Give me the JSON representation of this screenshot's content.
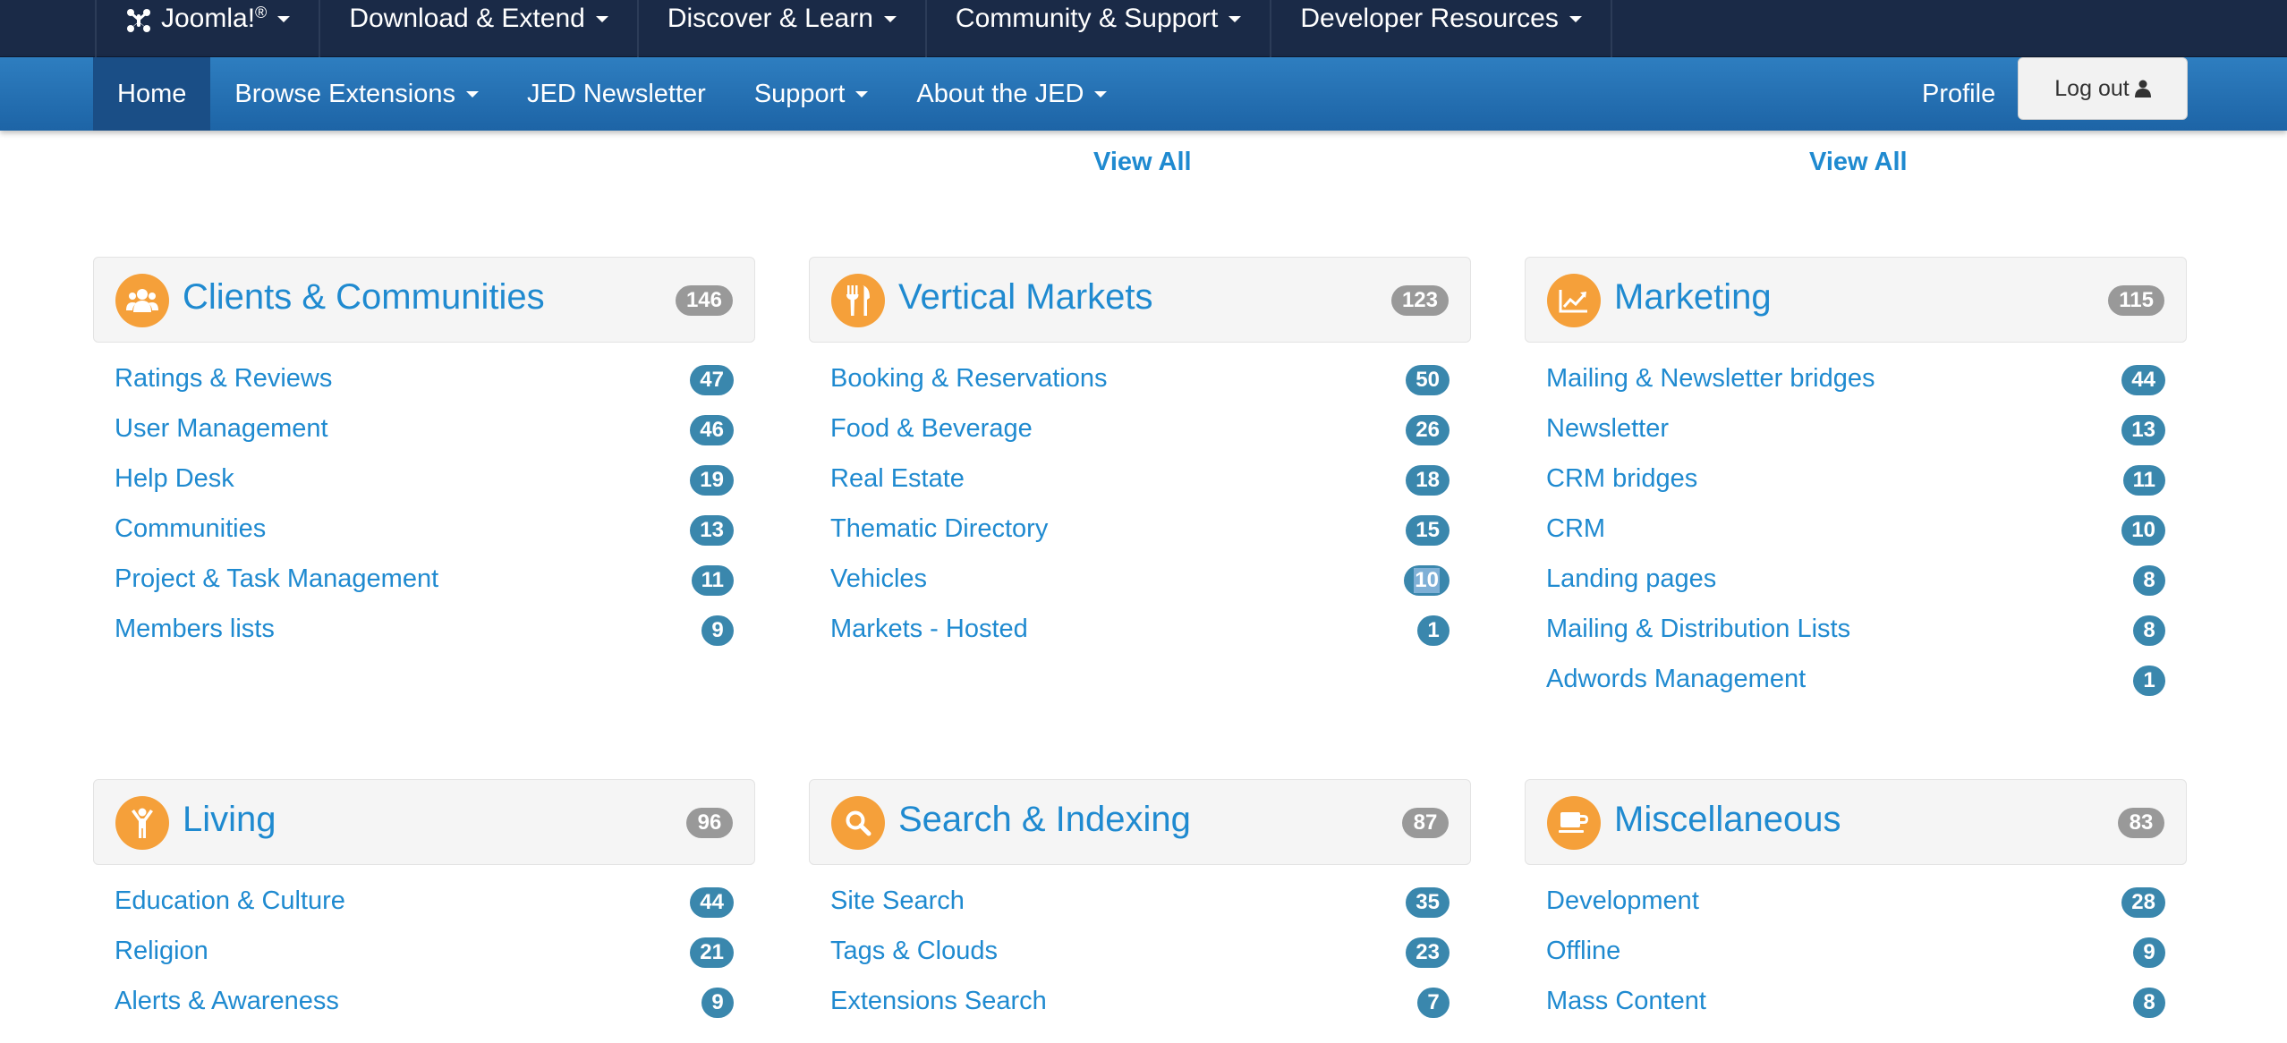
{
  "topbar": {
    "items": [
      {
        "label": "Joomla!",
        "sup": "®"
      },
      {
        "label": "Download & Extend"
      },
      {
        "label": "Discover & Learn"
      },
      {
        "label": "Community & Support"
      },
      {
        "label": "Developer Resources"
      }
    ],
    "icons": {
      "logo": "joomla-logo-icon",
      "caret": "caret-down-icon"
    }
  },
  "mainnav": {
    "items": [
      {
        "label": "Home",
        "active": true
      },
      {
        "label": "Browse Extensions",
        "dropdown": true
      },
      {
        "label": "JED Newsletter",
        "dropdown": false
      },
      {
        "label": "Support",
        "dropdown": true
      },
      {
        "label": "About the JED",
        "dropdown": true
      }
    ],
    "profile": "Profile",
    "logout": "Log out",
    "logout_icon": "user-icon"
  },
  "view_all": [
    "View All",
    "View All"
  ],
  "colors": {
    "link": "#1f8ad0",
    "icon_circle": "#f5a03a",
    "badge": "#3a87ad",
    "badge_total": "#999999",
    "topbar": "#1a2a47",
    "mainnav": "#2472b6"
  },
  "categories": [
    {
      "title": "Clients & Communities",
      "count": "146",
      "icon": "users-icon",
      "items": [
        {
          "name": "Ratings & Reviews",
          "count": "47"
        },
        {
          "name": "User Management",
          "count": "46"
        },
        {
          "name": "Help Desk",
          "count": "19"
        },
        {
          "name": "Communities",
          "count": "13"
        },
        {
          "name": "Project & Task Management",
          "count": "11"
        },
        {
          "name": "Members lists",
          "count": "9"
        }
      ]
    },
    {
      "title": "Vertical Markets",
      "count": "123",
      "icon": "fork-knife-icon",
      "items": [
        {
          "name": "Booking & Reservations",
          "count": "50"
        },
        {
          "name": "Food & Beverage",
          "count": "26"
        },
        {
          "name": "Real Estate",
          "count": "18"
        },
        {
          "name": "Thematic Directory",
          "count": "15"
        },
        {
          "name": "Vehicles",
          "count": "10"
        },
        {
          "name": "Markets - Hosted",
          "count": "1"
        }
      ]
    },
    {
      "title": "Marketing",
      "count": "115",
      "icon": "line-chart-icon",
      "items": [
        {
          "name": "Mailing & Newsletter bridges",
          "count": "44"
        },
        {
          "name": "Newsletter",
          "count": "13"
        },
        {
          "name": "CRM bridges",
          "count": "11"
        },
        {
          "name": "CRM",
          "count": "10"
        },
        {
          "name": "Landing pages",
          "count": "8"
        },
        {
          "name": "Mailing & Distribution Lists",
          "count": "8"
        },
        {
          "name": "Adwords Management",
          "count": "1"
        }
      ]
    },
    {
      "title": "Living",
      "count": "96",
      "icon": "person-icon",
      "items": [
        {
          "name": "Education & Culture",
          "count": "44"
        },
        {
          "name": "Religion",
          "count": "21"
        },
        {
          "name": "Alerts & Awareness",
          "count": "9"
        }
      ]
    },
    {
      "title": "Search & Indexing",
      "count": "87",
      "icon": "search-icon",
      "items": [
        {
          "name": "Site Search",
          "count": "35"
        },
        {
          "name": "Tags & Clouds",
          "count": "23"
        },
        {
          "name": "Extensions Search",
          "count": "7"
        }
      ]
    },
    {
      "title": "Miscellaneous",
      "count": "83",
      "icon": "coffee-cup-icon",
      "items": [
        {
          "name": "Development",
          "count": "28"
        },
        {
          "name": "Offline",
          "count": "9"
        },
        {
          "name": "Mass Content",
          "count": "8"
        }
      ]
    }
  ]
}
